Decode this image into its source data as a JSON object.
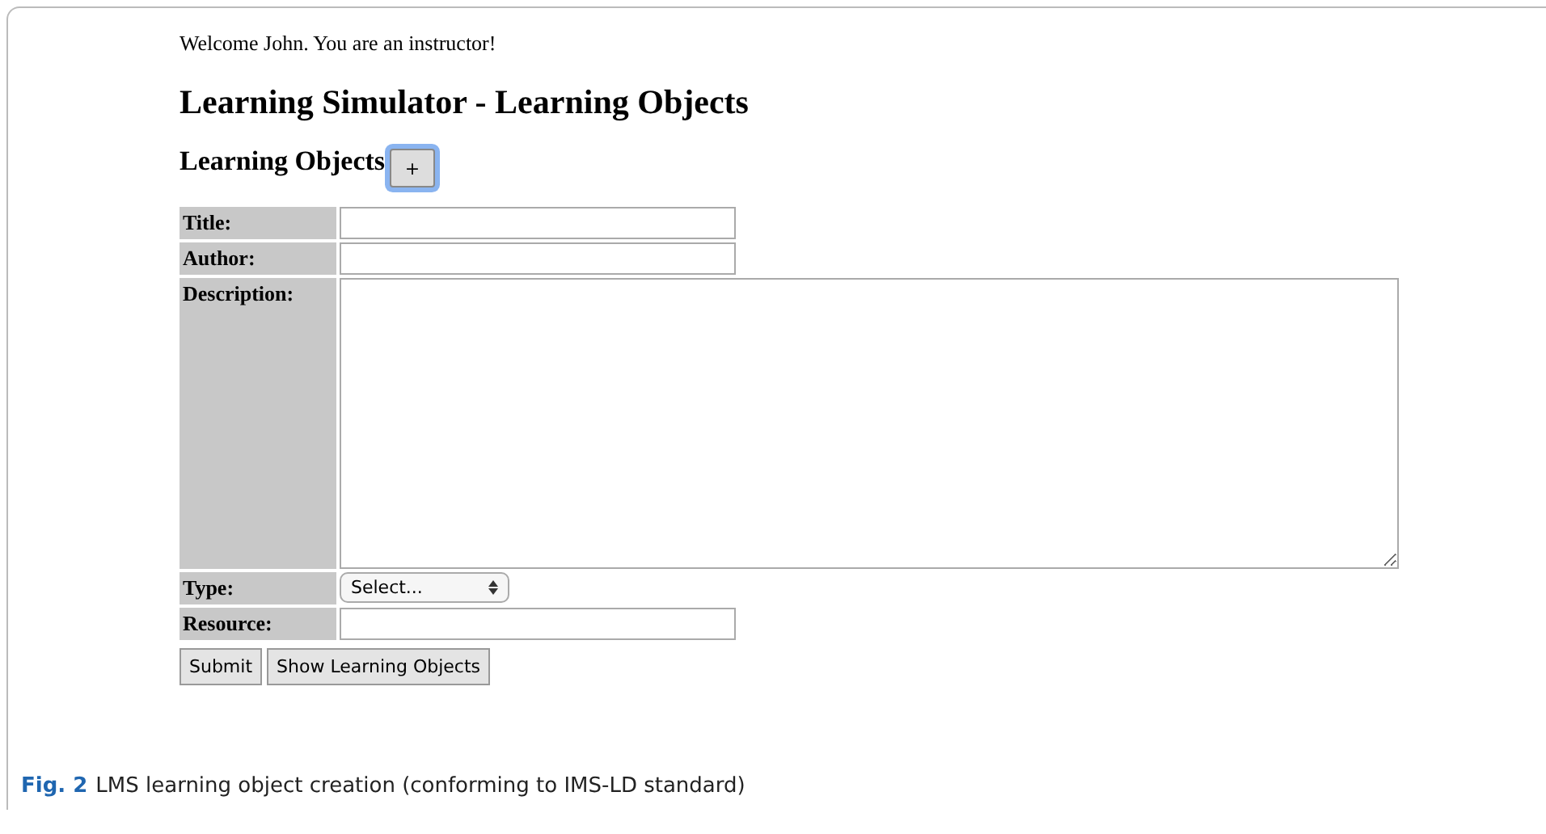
{
  "page": {
    "welcome": "Welcome John. You are an instructor!",
    "title": "Learning Simulator - Learning Objects",
    "section_heading": "Learning Objects",
    "add_button": "+"
  },
  "form": {
    "fields": [
      {
        "label": "Title:",
        "kind": "text"
      },
      {
        "label": "Author:",
        "kind": "text"
      },
      {
        "label": "Description:",
        "kind": "textarea"
      },
      {
        "label": "Type:",
        "kind": "select",
        "value": "Select..."
      },
      {
        "label": "Resource:",
        "kind": "text"
      }
    ],
    "buttons": [
      "Submit",
      "Show Learning Objects"
    ]
  },
  "caption": {
    "label": "Fig. 2",
    "text": "LMS learning object creation (conforming to IMS-LD standard)"
  }
}
